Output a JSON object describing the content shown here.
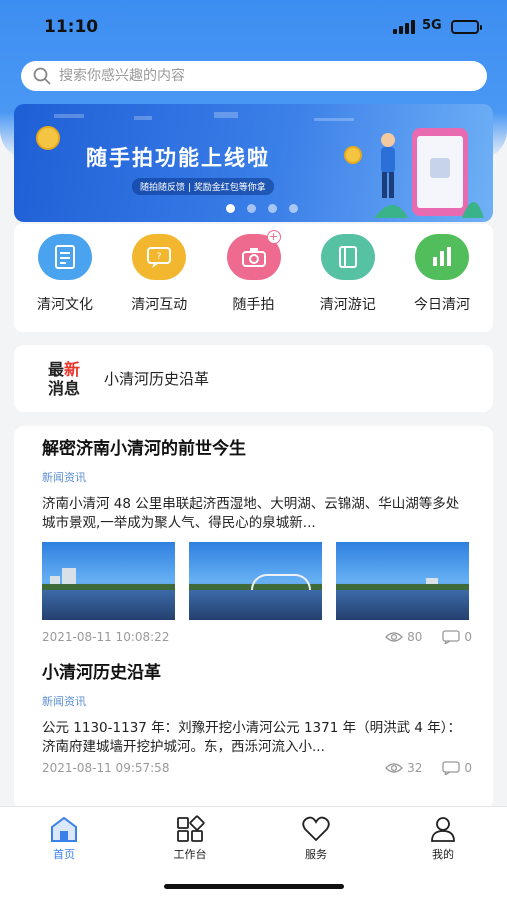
{
  "status_bar": {
    "time": "11:10",
    "network": "5G"
  },
  "search": {
    "placeholder": "搜索你感兴趣的内容"
  },
  "banner": {
    "title": "随手拍功能上线啦",
    "subtitle": "随拍随反馈 | 奖励金红包等你拿",
    "slide_count": 4,
    "active_slide": 1
  },
  "menu": {
    "items": [
      {
        "label": "清河文化",
        "icon": "document-icon",
        "color": "#4aa3ee"
      },
      {
        "label": "清河互动",
        "icon": "chat-icon",
        "color": "#f2b72e"
      },
      {
        "label": "随手拍",
        "icon": "camera-icon",
        "color": "#ef6a8f"
      },
      {
        "label": "清河游记",
        "icon": "book-icon",
        "color": "#57c1a4"
      },
      {
        "label": "今日清河",
        "icon": "bar-chart-icon",
        "color": "#52bd5b"
      }
    ]
  },
  "news_ticker": {
    "tag_top": "最新",
    "tag_bottom": "消息",
    "headline": "小清河历史沿革"
  },
  "articles": [
    {
      "title": "解密济南小清河的前世今生",
      "category": "新闻资讯",
      "excerpt": "济南小清河 48 公里串联起济西湿地、大明湖、云锦湖、华山湖等多处城市景观,一举成为聚人气、得民心的泉城新...",
      "time": "2021-08-11 10:08:22",
      "views": "80",
      "comments": "0"
    },
    {
      "title": "小清河历史沿革",
      "category": "新闻资讯",
      "excerpt": "公元 1130-1137 年：刘豫开挖小清河公元 1371 年（明洪武 4 年）：济南府建城墙开挖护城河。东，西泺河流入小...",
      "time": "2021-08-11 09:57:58",
      "views": "32",
      "comments": "0"
    }
  ],
  "tabbar": {
    "tabs": [
      {
        "label": "首页",
        "icon": "home-icon",
        "active": true
      },
      {
        "label": "工作台",
        "icon": "grid-icon",
        "active": false
      },
      {
        "label": "服务",
        "icon": "heart-icon",
        "active": false
      },
      {
        "label": "我的",
        "icon": "person-icon",
        "active": false
      }
    ]
  },
  "colors": {
    "primary": "#3b7fe8",
    "tag_red": "#e8362a"
  }
}
